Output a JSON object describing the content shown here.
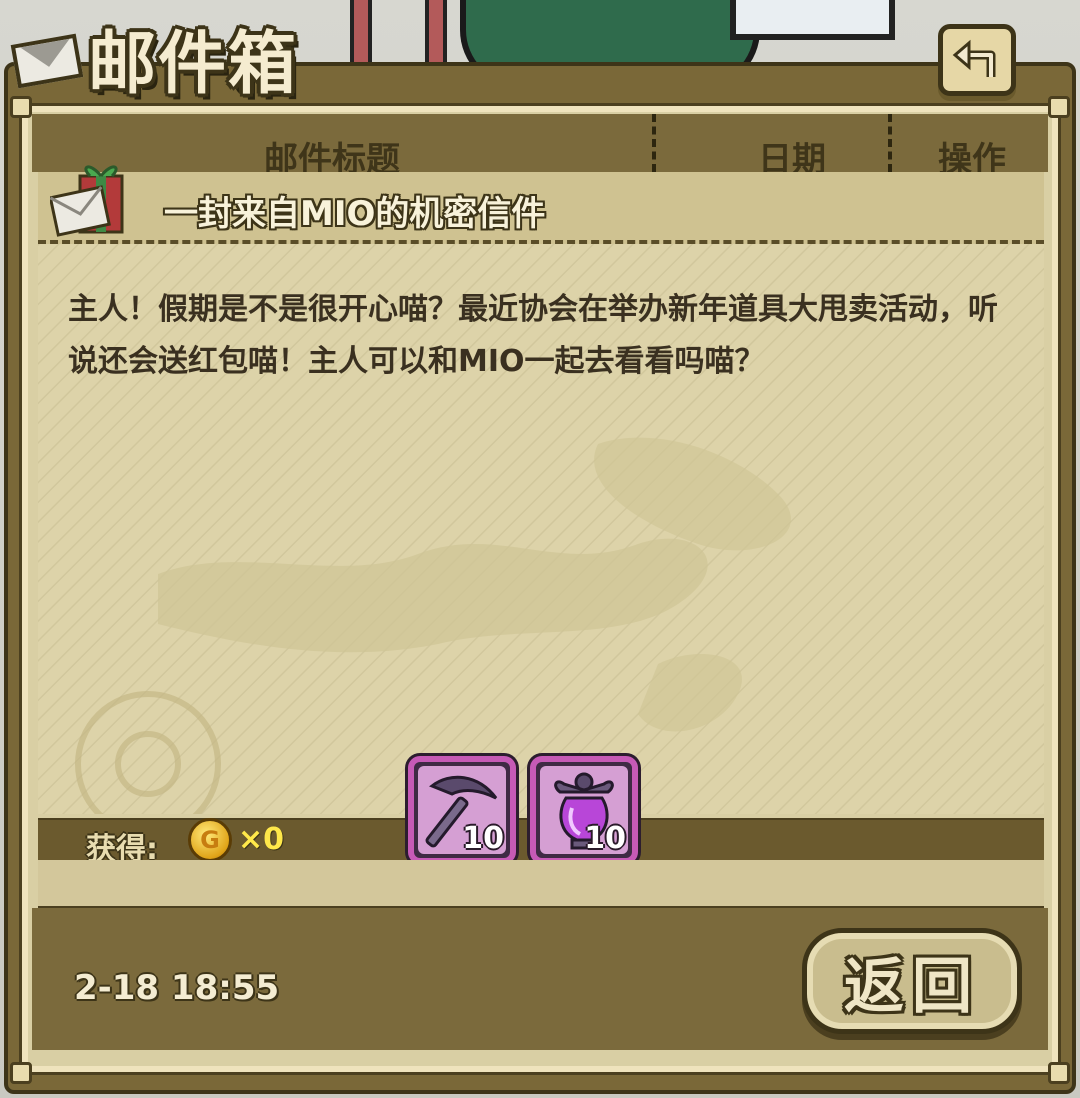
{
  "window": {
    "title": "邮件箱"
  },
  "header": {
    "col_subject": "邮件标题",
    "col_date": "日期",
    "col_action": "操作"
  },
  "mail": {
    "subject": "一封来自MIO的机密信件",
    "body": "主人！假期是不是很开心喵？最近协会在举办新年道具大甩卖活动，听说还会送红包喵！主人可以和MIO一起去看看吗喵？",
    "date": "2-18 18:55"
  },
  "rewards": {
    "label": "获得:",
    "coin_symbol": "G",
    "coin_count": "×0",
    "items": [
      {
        "icon": "pickaxe-icon",
        "qty": "10"
      },
      {
        "icon": "purple-potion-icon",
        "qty": "10"
      }
    ]
  },
  "buttons": {
    "return_label": "返回"
  },
  "colors": {
    "panel": "#7b6a3c",
    "paper": "#d9cfa4",
    "item_border": "#c65ab6",
    "coin_text": "#ffe84a"
  }
}
